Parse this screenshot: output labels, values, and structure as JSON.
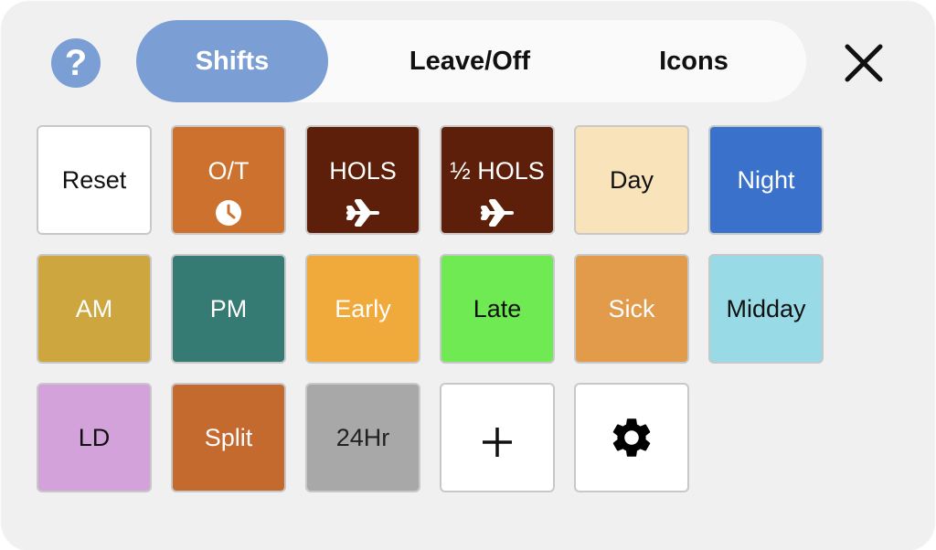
{
  "header": {
    "help_label": "?",
    "tabs": [
      {
        "label": "Shifts",
        "active": true
      },
      {
        "label": "Leave/Off",
        "active": false
      },
      {
        "label": "Icons",
        "active": false
      }
    ]
  },
  "colors": {
    "accent": "#7b9fd4",
    "panel_bg": "#f0f0f0"
  },
  "tiles": [
    {
      "label": "Reset",
      "bg": "#ffffff",
      "fg": "#111111"
    },
    {
      "label": "O/T",
      "bg": "#cd712e",
      "fg": "#ffffff",
      "icon": "clock-icon"
    },
    {
      "label": "HOLS",
      "bg": "#5e1f0a",
      "fg": "#ffffff",
      "icon": "airplane-icon"
    },
    {
      "label": "½ HOLS",
      "bg": "#5e1f0a",
      "fg": "#ffffff",
      "icon": "airplane-icon"
    },
    {
      "label": "Day",
      "bg": "#f9e3bb",
      "fg": "#111111"
    },
    {
      "label": "Night",
      "bg": "#3a72cb",
      "fg": "#ffffff"
    },
    {
      "label": "AM",
      "bg": "#cda640",
      "fg": "#ffffff"
    },
    {
      "label": "PM",
      "bg": "#357a73",
      "fg": "#ffffff"
    },
    {
      "label": "Early",
      "bg": "#f0a93b",
      "fg": "#ffffff"
    },
    {
      "label": "Late",
      "bg": "#6fea52",
      "fg": "#111111"
    },
    {
      "label": "Sick",
      "bg": "#e19b4b",
      "fg": "#ffffff"
    },
    {
      "label": "Midday",
      "bg": "#98dae6",
      "fg": "#111111"
    },
    {
      "label": "LD",
      "bg": "#d4a2da",
      "fg": "#111111"
    },
    {
      "label": "Split",
      "bg": "#c56a2f",
      "fg": "#ffffff"
    },
    {
      "label": "24Hr",
      "bg": "#a8a8a8",
      "fg": "#222222"
    }
  ],
  "actions": {
    "add_icon": "plus-icon",
    "settings_icon": "gear-icon"
  }
}
